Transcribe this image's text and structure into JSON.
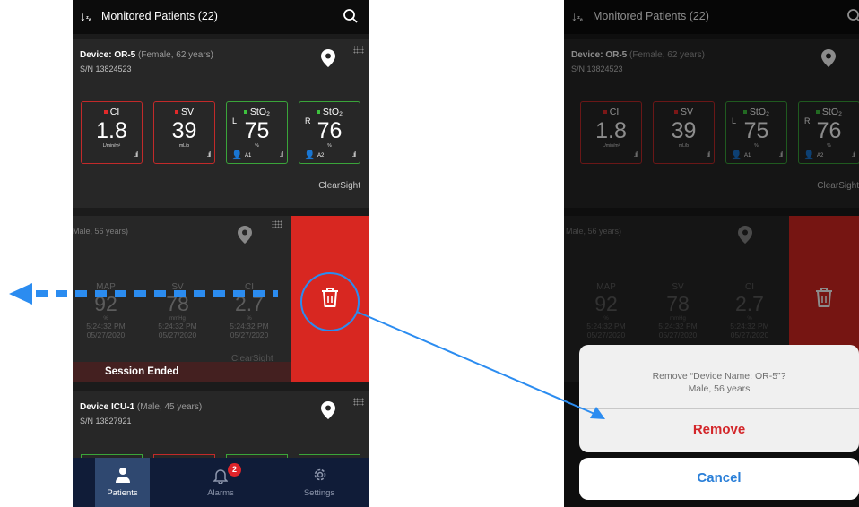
{
  "colors": {
    "accent": "#2b8cf0",
    "danger": "#d82721",
    "nav_bg": "#101c38",
    "red_border": "#c22a2a",
    "green_border": "#3aa53a"
  },
  "header": {
    "sort_icon": "sort-za-icon",
    "sort_glyph": "↓z/a",
    "title": "Monitored Patients (22)",
    "search_icon": "search-icon"
  },
  "cards": [
    {
      "device": "Device: OR-5",
      "detail": "(Female, 62 years)",
      "serial": "S/N 13824523",
      "footer": "ClearSight",
      "tiles": [
        {
          "name": "CI",
          "value": "1.8",
          "unit": "L/min/m²",
          "status": "red"
        },
        {
          "name": "SV",
          "value": "39",
          "unit": "mL/b",
          "status": "red"
        },
        {
          "side": "L",
          "name": "StO₂",
          "value": "75",
          "unit": "%",
          "location": "A1",
          "status": "green"
        },
        {
          "side": "R",
          "name": "StO₂",
          "value": "76",
          "unit": "%",
          "location": "A2",
          "status": "green"
        }
      ]
    },
    {
      "detail": "Male, 56 years)",
      "footer": "ClearSight",
      "session": "Session Ended",
      "metrics": [
        {
          "name": "MAP",
          "value": "92",
          "unit": "%",
          "time": "5:24:32 PM",
          "date": "05/27/2020"
        },
        {
          "name": "SV",
          "value": "78",
          "unit": "mmHg",
          "time": "5:24:32 PM",
          "date": "05/27/2020"
        },
        {
          "name": "CI",
          "value": "2.7",
          "unit": "%",
          "time": "5:24:32 PM",
          "date": "05/27/2020"
        }
      ]
    },
    {
      "device": "Device ICU-1",
      "detail": "(Male, 45 years)",
      "serial": "S/N 13827921"
    }
  ],
  "right_card2_detail": "Male, 56 years)",
  "nav": {
    "items": [
      {
        "label": "Patients",
        "icon": "person-icon"
      },
      {
        "label": "Alarms",
        "icon": "bell-icon",
        "badge": "2"
      },
      {
        "label": "Settings",
        "icon": "gear-icon"
      }
    ]
  },
  "dialog": {
    "line1": "Remove “Device Name: OR-5”?",
    "line2": "Male, 56 years",
    "remove_label": "Remove",
    "cancel_label": "Cancel"
  }
}
